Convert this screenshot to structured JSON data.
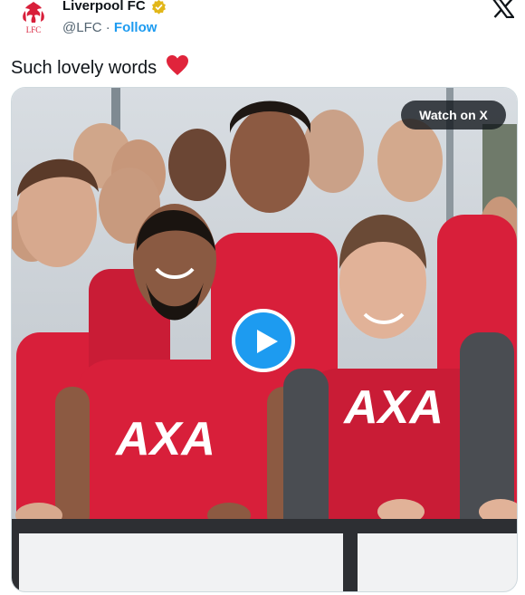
{
  "account": {
    "name": "Liverpool FC",
    "handle": "@LFC",
    "separator": "·",
    "follow_label": "Follow",
    "crest_text": "LFC"
  },
  "tweet": {
    "text": "Such lovely words"
  },
  "media": {
    "watch_label": "Watch on X",
    "sponsor_text": "AXA"
  },
  "icons": {
    "verified": "verified-badge-icon",
    "x_logo": "x-logo-icon",
    "heart": "red-heart-emoji",
    "play": "play-icon"
  },
  "colors": {
    "link_blue": "#1d9bf0",
    "verified_gold": "#e2b719",
    "kit_red": "#d81f3a",
    "heart_red": "#e0243b"
  }
}
